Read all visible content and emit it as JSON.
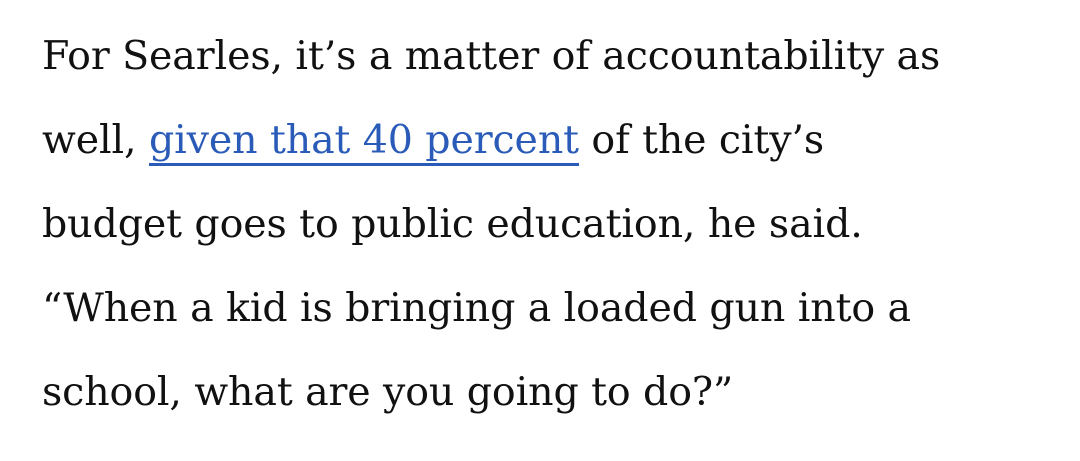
{
  "paragraph": {
    "line1": "For Searles, it’s a matter of accountability as",
    "line2_before": "well, ",
    "link_text": "given that 40 percent",
    "line2_after": " of the city’s",
    "line3": "budget goes to public education, he said.",
    "line4": "“When a kid is bringing a loaded gun into a",
    "line5": "school, what are you going to do?”"
  },
  "colors": {
    "text": "#111111",
    "link": "#2b5bb8",
    "background": "#ffffff"
  }
}
